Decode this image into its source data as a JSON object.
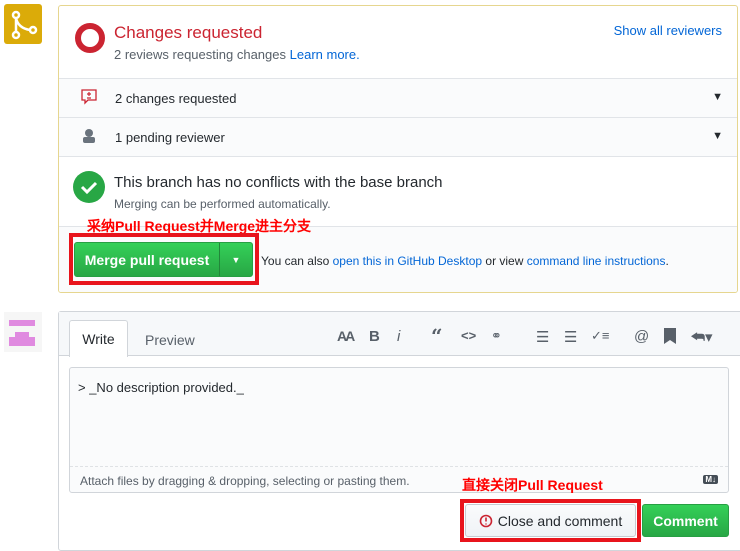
{
  "status": {
    "title": "Changes requested",
    "subtitle": "2 reviews requesting changes",
    "learn_more": "Learn more.",
    "show_all": "Show all reviewers"
  },
  "rows": [
    {
      "label": "2 changes requested",
      "icon": "file-diff-comment-icon"
    },
    {
      "label": "1 pending reviewer",
      "icon": "person-icon"
    }
  ],
  "merge_status": {
    "title": "This branch has no conflicts with the base branch",
    "subtitle": "Merging can be performed automatically."
  },
  "merge": {
    "button": "Merge pull request",
    "also_prefix": "You can also",
    "desktop_link": "open this in GitHub Desktop",
    "or_view": "or view",
    "cli_link": "command line instructions",
    "suffix": "."
  },
  "annotations": {
    "merge": "采纳Pull Request并Merge进主分支",
    "close": "直接关闭Pull Request"
  },
  "editor": {
    "tabs": [
      "Write",
      "Preview"
    ],
    "text": "> _No description provided._",
    "attach": "Attach files by dragging & dropping, selecting or pasting them.",
    "markdown_badge": "M↓",
    "toolbar": {
      "heading": "AA",
      "bold": "B",
      "italic": "i"
    }
  },
  "actions": {
    "close": "Close and comment",
    "comment": "Comment"
  },
  "colors": {
    "red": "#cb2431",
    "green": "#28a745",
    "annotation": "#e8141c"
  }
}
